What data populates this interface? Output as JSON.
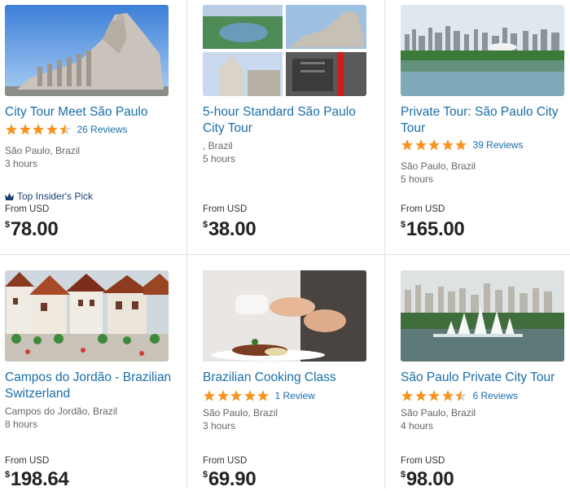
{
  "tours": [
    {
      "title": "City Tour Meet São Paulo",
      "rating": 4.5,
      "reviews": "26 Reviews",
      "location": "São Paulo, Brazil",
      "duration": "3 hours",
      "badge": "Top Insider's Pick",
      "from_label": "From USD",
      "currency_symbol": "$",
      "price": "78.00"
    },
    {
      "title": "5-hour Standard São Paulo City Tour",
      "rating": null,
      "reviews": "",
      "location": ", Brazil",
      "duration": "5 hours",
      "badge": "",
      "from_label": "From USD",
      "currency_symbol": "$",
      "price": "38.00"
    },
    {
      "title": "Private Tour: São Paulo City Tour",
      "rating": 5,
      "reviews": "39 Reviews",
      "location": "São Paulo, Brazil",
      "duration": "5 hours",
      "badge": "",
      "from_label": "From USD",
      "currency_symbol": "$",
      "price": "165.00"
    },
    {
      "title": "Campos do Jordão - Brazilian Switzerland",
      "rating": null,
      "reviews": "",
      "location": "Campos do Jordão, Brazil",
      "duration": "8 hours",
      "badge": "",
      "from_label": "From USD",
      "currency_symbol": "$",
      "price": "198.64"
    },
    {
      "title": "Brazilian Cooking Class",
      "rating": 5,
      "reviews": "1 Review",
      "location": "São Paulo, Brazil",
      "duration": "3 hours",
      "badge": "",
      "from_label": "From USD",
      "currency_symbol": "$",
      "price": "69.90"
    },
    {
      "title": "São Paulo Private City Tour",
      "rating": 4.5,
      "reviews": "6 Reviews",
      "location": "São Paulo, Brazil",
      "duration": "4 hours",
      "badge": "",
      "from_label": "From USD",
      "currency_symbol": "$",
      "price": "98.00"
    }
  ],
  "colors": {
    "link": "#1a6ea8",
    "star": "#f7931e",
    "badge": "#1c3f73",
    "divider": "#e2e2e2"
  }
}
